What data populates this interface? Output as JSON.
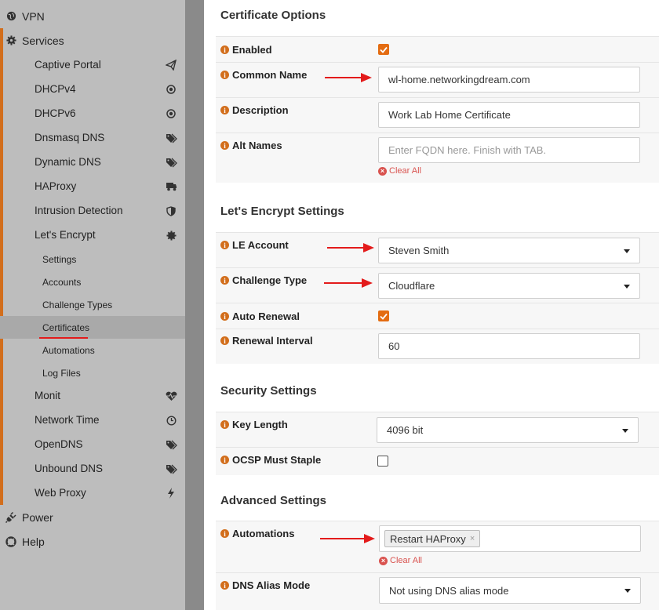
{
  "sidebar": {
    "top": [
      {
        "label": "VPN",
        "icon": "globe-icon"
      },
      {
        "label": "Services",
        "icon": "gear-icon"
      }
    ],
    "services": [
      {
        "label": "Captive Portal",
        "icon": "paper-plane-icon"
      },
      {
        "label": "DHCPv4",
        "icon": "bullseye-icon"
      },
      {
        "label": "DHCPv6",
        "icon": "bullseye-icon"
      },
      {
        "label": "Dnsmasq DNS",
        "icon": "tags-icon"
      },
      {
        "label": "Dynamic DNS",
        "icon": "tags-icon"
      },
      {
        "label": "HAProxy",
        "icon": "truck-icon"
      },
      {
        "label": "Intrusion Detection",
        "icon": "shield-icon"
      },
      {
        "label": "Let's Encrypt",
        "icon": "certificate-icon"
      }
    ],
    "letsencrypt_sub": [
      {
        "label": "Settings"
      },
      {
        "label": "Accounts"
      },
      {
        "label": "Challenge Types"
      },
      {
        "label": "Certificates",
        "active": true
      },
      {
        "label": "Automations"
      },
      {
        "label": "Log Files"
      }
    ],
    "services_after": [
      {
        "label": "Monit",
        "icon": "heartbeat-icon"
      },
      {
        "label": "Network Time",
        "icon": "clock-icon"
      },
      {
        "label": "OpenDNS",
        "icon": "tags-icon"
      },
      {
        "label": "Unbound DNS",
        "icon": "tags-icon"
      },
      {
        "label": "Web Proxy",
        "icon": "bolt-icon"
      }
    ],
    "bottom": [
      {
        "label": "Power",
        "icon": "plug-icon"
      },
      {
        "label": "Help",
        "icon": "life-ring-icon"
      }
    ]
  },
  "colors": {
    "accent": "#d26e1c",
    "checkbox": "#e46c12",
    "arrow": "#e31b1b",
    "clear": "#d9534f"
  },
  "form": {
    "certificate_options": {
      "title": "Certificate Options",
      "enabled": {
        "label": "Enabled",
        "checked": true
      },
      "common_name": {
        "label": "Common Name",
        "value": "wl-home.networkingdream.com"
      },
      "description": {
        "label": "Description",
        "value": "Work Lab Home Certificate"
      },
      "alt_names": {
        "label": "Alt Names",
        "placeholder": "Enter FQDN here. Finish with TAB.",
        "clear": "Clear All"
      }
    },
    "le_settings": {
      "title": "Let's Encrypt Settings",
      "le_account": {
        "label": "LE Account",
        "value": "Steven Smith"
      },
      "challenge_type": {
        "label": "Challenge Type",
        "value": "Cloudflare"
      },
      "auto_renewal": {
        "label": "Auto Renewal",
        "checked": true
      },
      "renewal_interval": {
        "label": "Renewal Interval",
        "value": "60"
      }
    },
    "security": {
      "title": "Security Settings",
      "key_length": {
        "label": "Key Length",
        "value": "4096 bit"
      },
      "ocsp": {
        "label": "OCSP Must Staple",
        "checked": false
      }
    },
    "advanced": {
      "title": "Advanced Settings",
      "automations": {
        "label": "Automations",
        "tag": "Restart HAProxy",
        "tag_remove": "×",
        "clear": "Clear All"
      },
      "dns_alias": {
        "label": "DNS Alias Mode",
        "value": "Not using DNS alias mode"
      }
    }
  }
}
